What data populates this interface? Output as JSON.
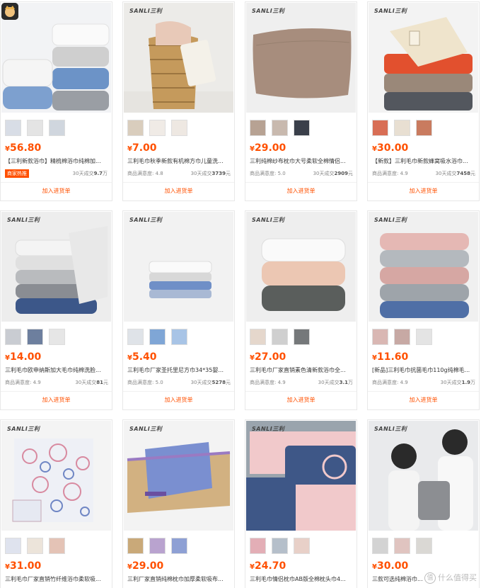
{
  "stock_button_label": "加入进货单",
  "products": [
    {
      "brand": "SANLI三利",
      "price_symbol": "¥",
      "price": "56.80",
      "title": "【三利新款浴巾】精梳棉浴巾纯棉加...",
      "badge": "商家热推",
      "satisfaction_label": "",
      "satisfaction": "",
      "sales_label": "30天成交",
      "sales_value": "9.7",
      "sales_unit": "万"
    },
    {
      "brand": "SANLI三利",
      "price_symbol": "¥",
      "price": "7.00",
      "title": "三利毛巾秋季新款有机棉方巾儿童洗...",
      "badge": "",
      "satisfaction_label": "商品满意度:",
      "satisfaction": "4.8",
      "sales_label": "30天成交",
      "sales_value": "3739",
      "sales_unit": "元"
    },
    {
      "brand": "SANLI三利",
      "price_symbol": "¥",
      "price": "29.00",
      "title": "三利纯棉纱布枕巾大号柔软全棉情侣...",
      "badge": "",
      "satisfaction_label": "商品满意度:",
      "satisfaction": "5.0",
      "sales_label": "30天成交",
      "sales_value": "2909",
      "sales_unit": "元"
    },
    {
      "brand": "SANLI三利",
      "price_symbol": "¥",
      "price": "30.00",
      "title": "【新款】三利毛巾新款蜂窝吸水浴巾...",
      "badge": "",
      "satisfaction_label": "商品满意度:",
      "satisfaction": "4.9",
      "sales_label": "30天成交",
      "sales_value": "7458",
      "sales_unit": "元"
    },
    {
      "brand": "SANLI三利",
      "price_symbol": "¥",
      "price": "14.00",
      "title": "三利毛巾欧申纳斯加大毛巾纯棉洗脸...",
      "badge": "",
      "satisfaction_label": "商品满意度:",
      "satisfaction": "4.9",
      "sales_label": "30天成交",
      "sales_value": "81",
      "sales_unit": "元"
    },
    {
      "brand": "SANLI三利",
      "price_symbol": "¥",
      "price": "5.40",
      "title": "三利毛巾厂家圣托里尼方巾34*35婴...",
      "badge": "",
      "satisfaction_label": "商品满意度:",
      "satisfaction": "5.0",
      "sales_label": "30天成交",
      "sales_value": "5278",
      "sales_unit": "元"
    },
    {
      "brand": "SANLI三利",
      "price_symbol": "¥",
      "price": "27.00",
      "title": "三利毛巾厂家直销素色清新款浴巾全...",
      "badge": "",
      "satisfaction_label": "商品满意度:",
      "satisfaction": "4.9",
      "sales_label": "30天成交",
      "sales_value": "3.1",
      "sales_unit": "万"
    },
    {
      "brand": "SANLI三利",
      "price_symbol": "¥",
      "price": "11.60",
      "title": "[新品]三利毛巾抗菌毛巾110g纯棉毛...",
      "badge": "",
      "satisfaction_label": "商品满意度:",
      "satisfaction": "4.9",
      "sales_label": "30天成交",
      "sales_value": "1.9",
      "sales_unit": "万"
    },
    {
      "brand": "SANLI三利",
      "price_symbol": "¥",
      "price": "31.00",
      "title": "三利毛巾厂家直销竹纤维浴巾柔软吸...",
      "badge": "",
      "satisfaction_label": "",
      "satisfaction": "",
      "sales_label": "",
      "sales_value": "",
      "sales_unit": ""
    },
    {
      "brand": "SANLI三利",
      "price_symbol": "¥",
      "price": "29.00",
      "title": "三利厂家直销纯棉枕巾加厚柔软吸布...",
      "badge": "",
      "satisfaction_label": "",
      "satisfaction": "",
      "sales_label": "",
      "sales_value": "",
      "sales_unit": ""
    },
    {
      "brand": "SANLI三利",
      "price_symbol": "¥",
      "price": "24.70",
      "title": "三利毛巾情侣枕巾AB版全棉枕头巾4...",
      "badge": "",
      "satisfaction_label": "",
      "satisfaction": "",
      "sales_label": "",
      "sales_value": "",
      "sales_unit": ""
    },
    {
      "brand": "SANLI三利",
      "price_symbol": "¥",
      "price": "30.00",
      "title": "三款可选纯棉浴巾...",
      "badge": "",
      "satisfaction_label": "",
      "satisfaction": "",
      "sales_label": "",
      "sales_value": "",
      "sales_unit": ""
    }
  ],
  "watermark": {
    "logo": "值",
    "text": "什么值得买"
  }
}
